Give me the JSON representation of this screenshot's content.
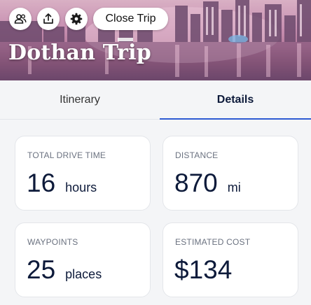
{
  "header": {
    "title": "Dothan Trip",
    "close_trip_label": "Close Trip",
    "buttons": [
      {
        "name": "travelers-button",
        "icon": "group-icon"
      },
      {
        "name": "share-button",
        "icon": "upload-icon"
      },
      {
        "name": "settings-button",
        "icon": "gear-icon"
      }
    ]
  },
  "tabs": [
    {
      "label": "Itinerary",
      "active": false
    },
    {
      "label": "Details",
      "active": true
    }
  ],
  "stats": {
    "drive_time": {
      "label": "TOTAL DRIVE TIME",
      "value": "16",
      "unit": "hours"
    },
    "distance": {
      "label": "DISTANCE",
      "value": "870",
      "unit": "mi"
    },
    "waypoints": {
      "label": "WAYPOINTS",
      "value": "25",
      "unit": "places"
    },
    "cost": {
      "label": "ESTIMATED COST",
      "value": "$134",
      "unit": ""
    }
  },
  "colors": {
    "accent": "#2e5bd3",
    "text_primary": "#0d1a3a",
    "text_muted": "#6b7280",
    "card_bg": "#ffffff",
    "page_bg": "#f4f5f7"
  }
}
